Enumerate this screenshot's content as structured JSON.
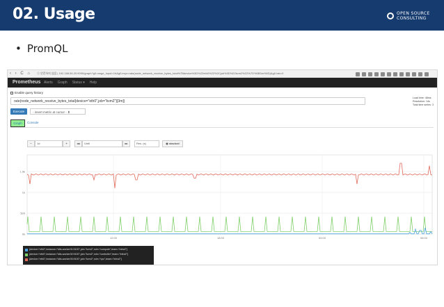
{
  "slide": {
    "title": "02. Usage",
    "logo_line1": "OPEN SOURCE",
    "logo_line2": "CONSULTING",
    "bullet": "PromQL"
  },
  "browser": {
    "nav": "‹ › C ⌂",
    "url": "① 안전하지 않음 | 192.168.56.20:9090/graph?g0.range_input=1h&g0.expr=rate(node_network_receive_bytes_total%7Bdevice%3D%22eth0%22%2Cjob%3D%22kvm2%22%7D%5B3m%5D)&g0.tab=0"
  },
  "prometheus": {
    "brand": "Prometheus",
    "nav": [
      "Alerts",
      "Graph",
      "Status ▾",
      "Help"
    ],
    "query_history": "Enable query history",
    "expression": "rate(node_network_receive_bytes_total{device=\"eth0\",job=\"kvm2\"}[3m])",
    "stats": [
      "Load time: 48ms",
      "Resolution: 14s",
      "Total time series: 3"
    ],
    "execute": "Execute",
    "insert_metric": "- insert metric at cursor -  ⬍",
    "tab_graph": "Graph",
    "tab_console": "Console",
    "controls": {
      "minus": "−",
      "range": "1d",
      "plus": "+",
      "back": "◂◂",
      "end": "Until",
      "forward": "▸▸",
      "res": "Res. (s)",
      "stacked": "◉ stacked"
    }
  },
  "chart_data": {
    "type": "line",
    "y_ticks": [
      "1.5k",
      "1k",
      "500",
      "0k"
    ],
    "x_ticks": [
      "12:00",
      "18:00",
      "00:00",
      "06:00"
    ],
    "series": [
      {
        "name": "{device=\"eth0\",instance=\"k8s-worker01:9100\",job=\"kvm2\",role=\"compute\",team=\"infra2\"}",
        "color": "#4aa3df",
        "baseline": 0,
        "spikes": [
          [
            570,
            40
          ],
          [
            578,
            120
          ],
          [
            585,
            90
          ],
          [
            592,
            150
          ],
          [
            600,
            60
          ],
          [
            606,
            110
          ]
        ]
      },
      {
        "name": "{device=\"eth0\",instance=\"k8s-worker02:9100\",job=\"kvm2\",role=\"controller\",team=\"infra2\"}",
        "color": "#7fcf6a",
        "baseline": 60,
        "period": 19,
        "spike": 360
      },
      {
        "name": "{device=\"eth0\",instance=\"k8s-worker03:9100\",job=\"kvm2\",role=\"vpc\",team=\"infra2\"}",
        "color": "#e06a5a",
        "baseline": 1430,
        "dips": [
          [
            4,
            1200
          ],
          [
            96,
            1300
          ],
          [
            126,
            1100
          ],
          [
            157,
            1300
          ],
          [
            241,
            1340
          ],
          [
            474,
            1200
          ],
          [
            600,
            1380
          ]
        ],
        "peaks": [
          [
            557,
            1700
          ],
          [
            598,
            1640
          ]
        ]
      }
    ],
    "ylim": [
      0,
      1900
    ]
  }
}
